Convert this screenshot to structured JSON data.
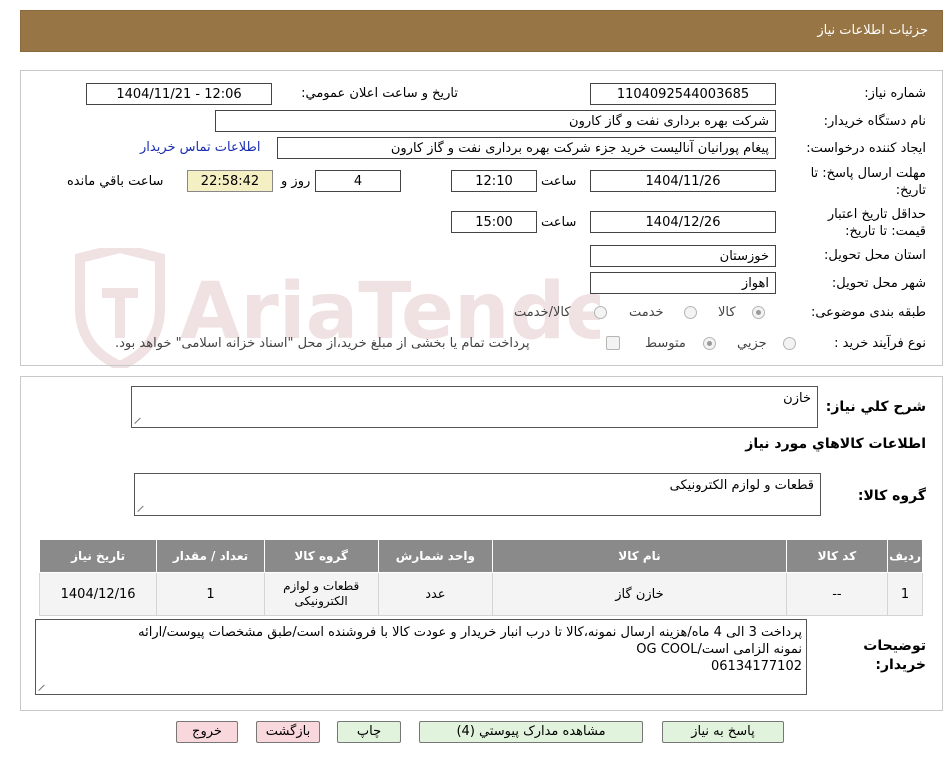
{
  "header": {
    "title": "جزئیات اطلاعات نیاز"
  },
  "form": {
    "need_number_label": "شماره نیاز:",
    "need_number": "1104092544003685",
    "announce_label": "تاریخ و ساعت اعلان عمومي:",
    "announce_value": "1404/11/21 - 12:06",
    "buyer_org_label": "نام دستگاه خريدار:",
    "buyer_org": "شرکت بهره برداری نفت و گاز کارون",
    "requester_label": "ايجاد کننده درخواست:",
    "requester": "پیغام پورانیان آنالیست خرید جزء شرکت بهره برداری نفت و گاز کارون",
    "contact_link": "اطلاعات تماس خريدار",
    "deadline_label": "مهلت ارسال پاسخ: تا تاریخ:",
    "deadline_date": "1404/11/26",
    "time_word": "ساعت",
    "deadline_time": "12:10",
    "days": "4",
    "days_word": "روز و",
    "remaining_time": "22:58:42",
    "remaining_label": "ساعت باقي مانده",
    "validity_label": "حداقل تاریخ اعتبار قیمت: تا تاریخ:",
    "validity_date": "1404/12/26",
    "validity_time": "15:00",
    "province_label": "استان محل تحویل:",
    "province": "خوزستان",
    "city_label": "شهر محل تحویل:",
    "city": "اهواز",
    "category_label": "طبقه بندی موضوعی:",
    "category_options": [
      "کالا",
      "خدمت",
      "کالا/خدمت"
    ],
    "process_label": "نوع فرآیند خرید :",
    "process_options": [
      "جزیي",
      "متوسط"
    ],
    "payment_note": "پرداخت تمام یا بخشی از مبلغ خرید،از محل \"اسناد خزانه اسلامی\" خواهد بود."
  },
  "description": {
    "label": "شرح کلي نياز:",
    "value": "خازن",
    "goods_info_title": "اطلاعات کالاهاي مورد نياز",
    "goods_group_label": "گروه کالا:",
    "goods_group": "قطعات و لوازم الکترونیکی"
  },
  "table": {
    "headers": [
      "رديف",
      "کد کالا",
      "نام کالا",
      "واحد شمارش",
      "گروه کالا",
      "تعداد / مقدار",
      "تاريخ نياز"
    ],
    "rows": [
      [
        "1",
        "--",
        "خازن گاز",
        "عدد",
        "قطعات و لوازم الکترونیکی",
        "1",
        "1404/12/16"
      ]
    ]
  },
  "notes": {
    "label_line1": "توضيحات",
    "label_line2": "خريدار:",
    "line1": "پرداخت 3 الی 4 ماه/هزینه ارسال نمونه،کالا تا درب انبار خریدار و عودت کالا با فروشنده است/طبق مشخصات پیوست/ارائه",
    "line2": "نمونه الزامی است/OG COOL",
    "line3": "06134177102"
  },
  "buttons": {
    "reply": "پاسخ به نياز",
    "attachments": "مشاهده مدارک پيوستي (4)",
    "print": "چاپ",
    "back": "بازگشت",
    "exit": "خروج"
  },
  "watermark": {
    "text": "AriaTender.neT"
  }
}
